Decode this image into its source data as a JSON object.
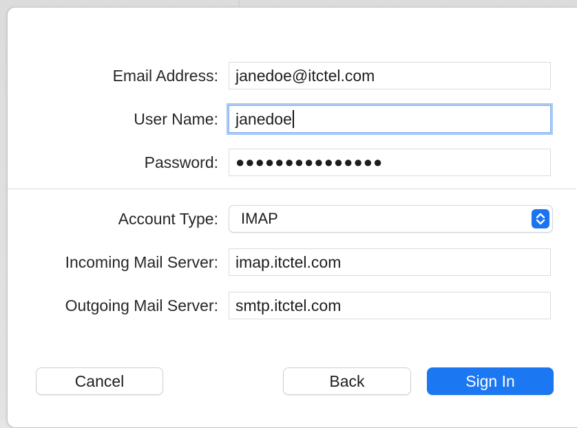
{
  "form": {
    "email": {
      "label": "Email Address:",
      "value": "janedoe@itctel.com"
    },
    "username": {
      "label": "User Name:",
      "value": "janedoe"
    },
    "password": {
      "label": "Password:",
      "value": "●●●●●●●●●●●●●●●"
    },
    "account_type": {
      "label": "Account Type:",
      "value": "IMAP"
    },
    "incoming": {
      "label": "Incoming Mail Server:",
      "value": "imap.itctel.com"
    },
    "outgoing": {
      "label": "Outgoing Mail Server:",
      "value": "smtp.itctel.com"
    }
  },
  "buttons": {
    "cancel": "Cancel",
    "back": "Back",
    "sign_in": "Sign In"
  },
  "colors": {
    "accent": "#1c78f2",
    "focus_ring": "#a9c8f5"
  },
  "icons": {
    "select_stepper": "chevron-up-down-icon"
  }
}
